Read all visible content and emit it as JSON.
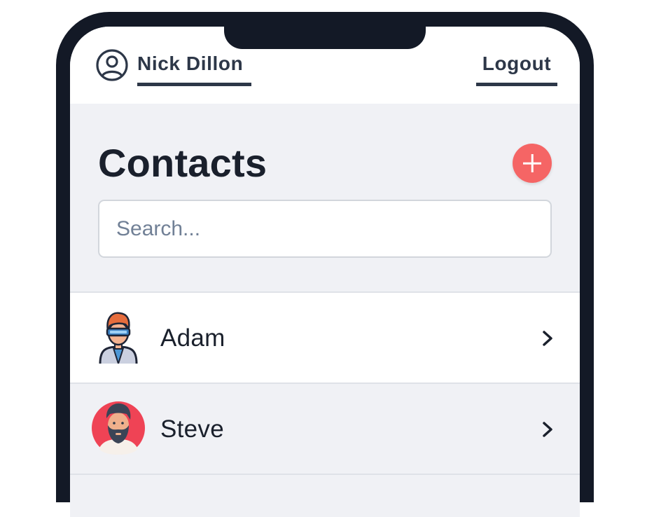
{
  "header": {
    "user_name": "Nick Dillon",
    "logout_label": "Logout"
  },
  "main": {
    "title": "Contacts",
    "add_button_icon": "plus-icon",
    "search": {
      "placeholder": "Search...",
      "value": ""
    }
  },
  "contacts": [
    {
      "name": "Adam",
      "avatar": "vr-headset-avatar"
    },
    {
      "name": "Steve",
      "avatar": "bearded-man-avatar"
    }
  ],
  "colors": {
    "accent": "#f56565",
    "text_dark": "#2d3748",
    "phone_frame": "#131926",
    "background": "#f0f1f5"
  }
}
